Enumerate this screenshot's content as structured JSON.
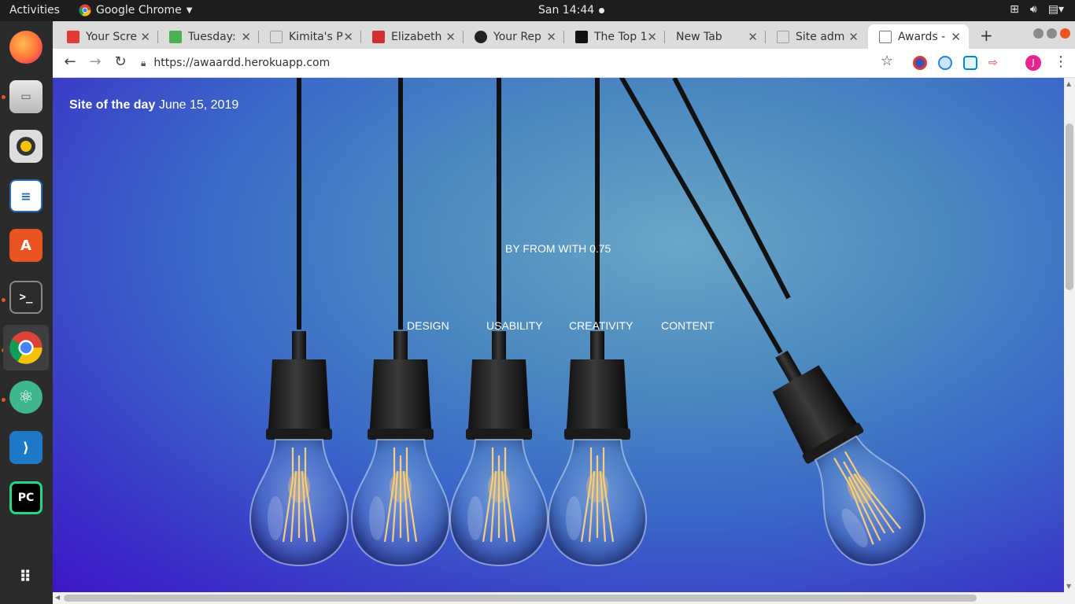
{
  "topbar": {
    "activities": "Activities",
    "app_name": "Google Chrome",
    "clock": "San 14:44"
  },
  "dock": {
    "items": [
      "firefox-icon",
      "files-icon",
      "rhythmbox-icon",
      "writer-icon",
      "software-center-icon",
      "terminal-icon",
      "chrome-icon",
      "atom-icon",
      "vscode-icon",
      "pycharm-icon",
      "show-apps-icon"
    ]
  },
  "tabs": [
    {
      "title": "Your Scre",
      "favicon_color": "#e53935"
    },
    {
      "title": "Tuesday:",
      "favicon_color": "#4caf50"
    },
    {
      "title": "Kimita's P",
      "favicon_color": "#9e9e9e"
    },
    {
      "title": "Elizabeth",
      "favicon_color": "#d32f2f"
    },
    {
      "title": "Your Rep",
      "favicon_color": "#222222"
    },
    {
      "title": "The Top 1",
      "favicon_color": "#111111"
    },
    {
      "title": "New Tab",
      "favicon_color": ""
    },
    {
      "title": "Site adm",
      "favicon_color": "#9e9e9e"
    },
    {
      "title": "Awards -",
      "favicon_color": "#9e9e9e"
    }
  ],
  "toolbar": {
    "url": "https://awaardd.herokuapp.com",
    "avatar_letter": "J"
  },
  "page": {
    "site_of_day_label": "Site of the day",
    "site_of_day_date": "June 15, 2019",
    "byline": "BY FROM WITH 0.75",
    "criteria": [
      "DESIGN",
      "USABILITY",
      "CREATIVITY",
      "CONTENT"
    ]
  },
  "colors": {
    "accent": "#e95420",
    "hero_blue": "#3a68c8",
    "hero_purple": "#3d16c4"
  }
}
